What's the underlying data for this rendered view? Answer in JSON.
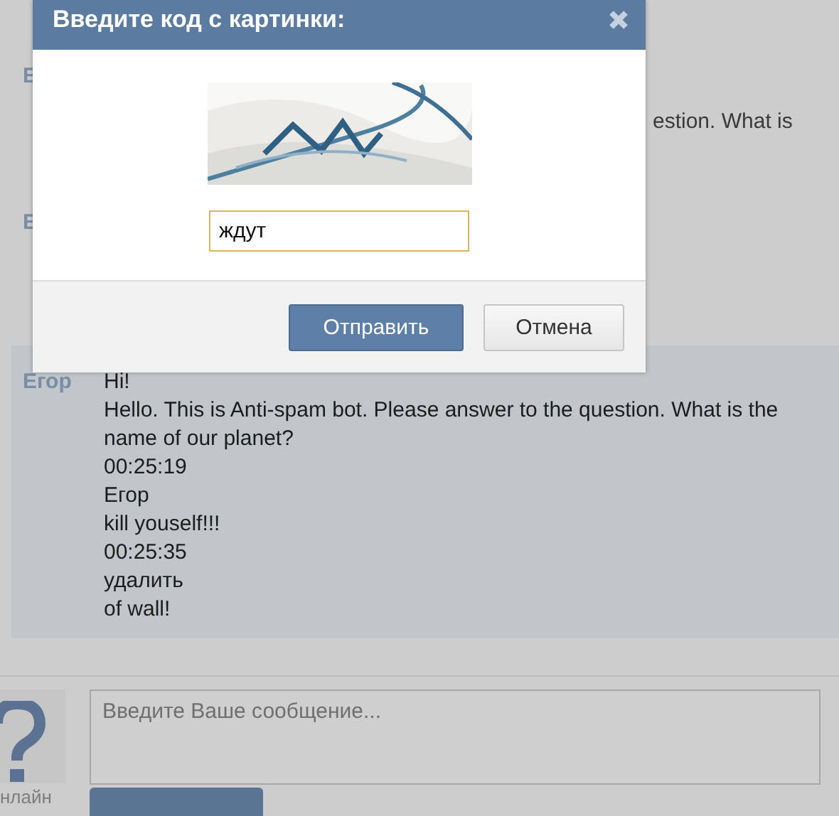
{
  "messages": [
    {
      "author": "Е",
      "selected": false,
      "lines": [
        "estion. What is"
      ]
    },
    {
      "author": "Е",
      "selected": false
    },
    {
      "author": "Егор",
      "selected": true,
      "lines": [
        "Hi!",
        "Hello. This is Anti-spam bot. Please answer to the question. What is the name of our planet?",
        "00:25:19",
        "Егор",
        "kill youself!!!",
        "00:25:35",
        "удалить",
        "of wall!"
      ]
    }
  ],
  "composer": {
    "status": "нлайн",
    "placeholder": "Введите Ваше сообщение..."
  },
  "dialog": {
    "title": "Введите код с картинки:",
    "input": {
      "value": "ждут"
    },
    "buttons": [
      {
        "label": "Отправить",
        "kind": "primary"
      },
      {
        "label": "Отмена",
        "kind": "secondary"
      }
    ]
  }
}
